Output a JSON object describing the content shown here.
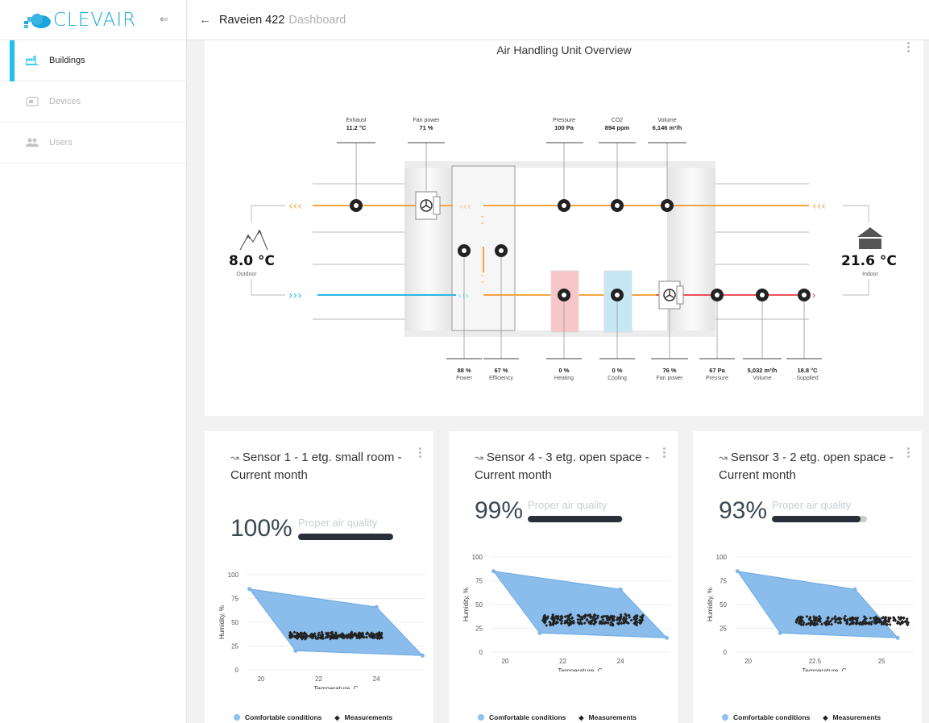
{
  "brand": {
    "name": "CLEVAIR"
  },
  "nav": [
    {
      "label": "Buildings",
      "icon": "factory-icon",
      "active": true
    },
    {
      "label": "Devices",
      "icon": "device-icon",
      "active": false
    },
    {
      "label": "Users",
      "icon": "users-icon",
      "active": false
    }
  ],
  "header": {
    "title": "Raveien 422",
    "subtitle": "Dashboard"
  },
  "ahu": {
    "title": "Air Handling Unit Overview",
    "top_metrics": [
      {
        "label": "Exhaust",
        "value": "11.2 °C"
      },
      {
        "label": "Fan power",
        "value": "71 %"
      },
      {
        "label": "Pressure",
        "value": "100 Pa"
      },
      {
        "label": "CO2",
        "value": "894 ppm"
      },
      {
        "label": "Volume",
        "value": "6,146 m³/h"
      }
    ],
    "bottom_metrics": [
      {
        "label": "Power",
        "value": "88 %"
      },
      {
        "label": "Efficiency",
        "value": "67 %"
      },
      {
        "label": "Heating",
        "value": "0 %"
      },
      {
        "label": "Cooling",
        "value": "0 %"
      },
      {
        "label": "Fan power",
        "value": "76 %"
      },
      {
        "label": "Pressure",
        "value": "67 Pa"
      },
      {
        "label": "Volume",
        "value": "5,032 m³/h"
      },
      {
        "label": "Supplied",
        "value": "18.8 °C"
      }
    ],
    "outdoor": {
      "temp": "8.0 °C",
      "label": "Outdoor"
    },
    "indoor": {
      "temp": "21.6 °C",
      "label": "Indoor"
    },
    "colors": {
      "exhaust": "#f5a442",
      "intake": "#2eb6e8",
      "supply": "#f0505a",
      "heating": "#f7c6c9",
      "cooling": "#c6e8f5"
    }
  },
  "sensors": [
    {
      "title": "Sensor 1 - 1 etg. small room - Current month",
      "percent": "100%",
      "quality_label": "Proper air quality",
      "quality": 1.0
    },
    {
      "title": "Sensor 4 - 3 etg. open space - Current month",
      "percent": "99%",
      "quality_label": "Proper air quality",
      "quality": 0.99
    },
    {
      "title": "Sensor 3 - 2 etg. open space - Current month",
      "percent": "93%",
      "quality_label": "Proper air quality",
      "quality": 0.93
    }
  ],
  "legend": {
    "comfort": "Comfortable conditions",
    "measurements": "Measurements"
  },
  "chart_data": [
    {
      "type": "scatter",
      "xlabel": "Temperature, C",
      "ylabel": "Humidity, %",
      "xlim": [
        19.5,
        25.7
      ],
      "ylim": [
        0,
        100
      ],
      "xticks": [
        "20",
        "22",
        "24"
      ],
      "xtick_values": [
        20,
        22,
        24
      ],
      "yticks": [
        "0",
        "25",
        "50",
        "75",
        "100"
      ],
      "comfort_zone": [
        [
          19.6,
          85
        ],
        [
          24,
          66
        ],
        [
          25.6,
          15
        ],
        [
          21.2,
          20
        ]
      ],
      "measurements": {
        "x_range": [
          21.0,
          24.2
        ],
        "y_range": [
          32,
          40
        ],
        "center_y": 36
      }
    },
    {
      "type": "scatter",
      "xlabel": "Temperature, C",
      "ylabel": "Humidity, %",
      "xlim": [
        19.5,
        25.7
      ],
      "ylim": [
        0,
        100
      ],
      "xticks": [
        "20",
        "22",
        "24"
      ],
      "xtick_values": [
        20,
        22,
        24
      ],
      "yticks": [
        "0",
        "25",
        "50",
        "75",
        "100"
      ],
      "comfort_zone": [
        [
          19.6,
          85
        ],
        [
          24,
          66
        ],
        [
          25.6,
          15
        ],
        [
          21.2,
          20
        ]
      ],
      "measurements": {
        "x_range": [
          21.3,
          24.8
        ],
        "y_range": [
          27,
          40
        ],
        "center_y": 34
      }
    },
    {
      "type": "scatter",
      "xlabel": "Temperature, C",
      "ylabel": "Humidity, %",
      "xlim": [
        19.5,
        26.2
      ],
      "ylim": [
        0,
        100
      ],
      "xticks": [
        "20",
        "22.5",
        "25"
      ],
      "xtick_values": [
        20,
        22.5,
        25
      ],
      "yticks": [
        "0",
        "25",
        "50",
        "75",
        "100"
      ],
      "comfort_zone": [
        [
          19.6,
          85
        ],
        [
          24,
          66
        ],
        [
          25.6,
          15
        ],
        [
          21.2,
          20
        ]
      ],
      "measurements": {
        "x_range": [
          21.8,
          26.0
        ],
        "y_range": [
          28,
          38
        ],
        "center_y": 33
      }
    }
  ]
}
